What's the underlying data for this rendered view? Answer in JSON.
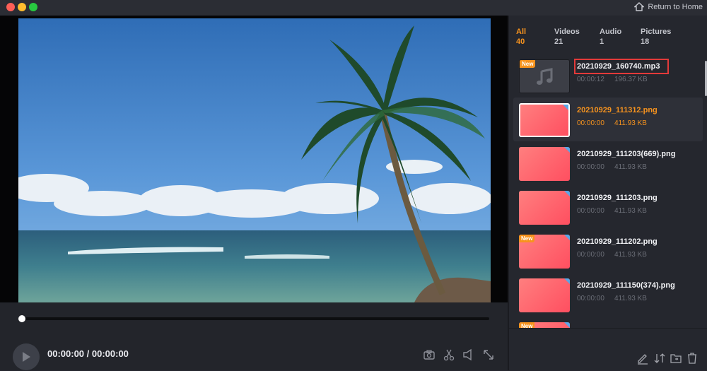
{
  "window": {
    "return_home_label": "Return to Home"
  },
  "player": {
    "time_display": "00:00:00 / 00:00:00",
    "progress": 0
  },
  "tabs": [
    {
      "label": "All",
      "count": "40",
      "active": true
    },
    {
      "label": "Videos",
      "count": "21",
      "active": false
    },
    {
      "label": "Audio",
      "count": "1",
      "active": false
    },
    {
      "label": "Pictures",
      "count": "18",
      "active": false
    }
  ],
  "files": [
    {
      "name": "20210929_160740.mp3",
      "duration": "00:00:12",
      "size": "196.37 KB",
      "kind": "audio",
      "is_new": true
    },
    {
      "name": "20210929_111312.png",
      "duration": "00:00:00",
      "size": "411.93 KB",
      "kind": "picture",
      "is_new": false,
      "selected": true
    },
    {
      "name": "20210929_111203(669).png",
      "duration": "00:00:00",
      "size": "411.93 KB",
      "kind": "picture",
      "is_new": false
    },
    {
      "name": "20210929_111203.png",
      "duration": "00:00:00",
      "size": "411.93 KB",
      "kind": "picture",
      "is_new": false
    },
    {
      "name": "20210929_111202.png",
      "duration": "00:00:00",
      "size": "411.93 KB",
      "kind": "picture",
      "is_new": true
    },
    {
      "name": "20210929_111150(374).png",
      "duration": "00:00:00",
      "size": "411.93 KB",
      "kind": "picture",
      "is_new": false
    }
  ],
  "badges": {
    "new_label": "New"
  },
  "colors": {
    "accent": "#f7931e",
    "highlight_box": "#e33a3a",
    "thumb_gradient_start": "#ff7f7f",
    "thumb_gradient_end": "#ff4f60"
  }
}
